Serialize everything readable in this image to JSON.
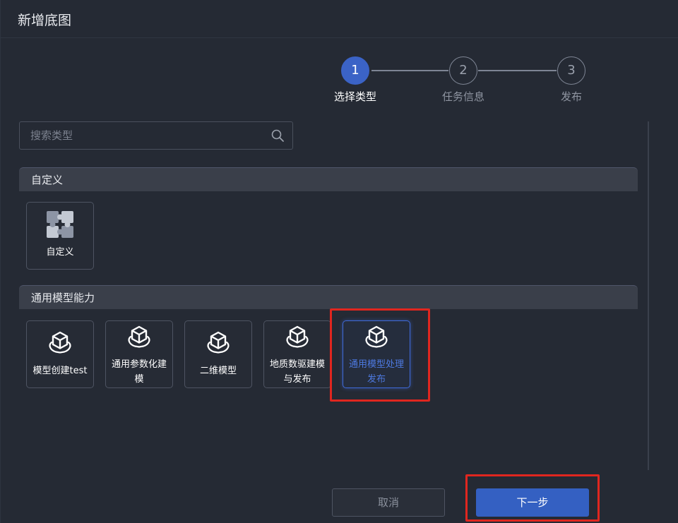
{
  "dialog": {
    "title": "新增底图"
  },
  "steps": [
    {
      "number": "1",
      "label": "选择类型",
      "active": true
    },
    {
      "number": "2",
      "label": "任务信息",
      "active": false
    },
    {
      "number": "3",
      "label": "发布",
      "active": false
    }
  ],
  "search": {
    "placeholder": "搜索类型",
    "value": ""
  },
  "sections": [
    {
      "title": "自定义",
      "items": [
        {
          "label": "自定义",
          "icon": "puzzle-icon"
        }
      ]
    },
    {
      "title": "通用模型能力",
      "items": [
        {
          "label": "模型创建test",
          "icon": "cube-icon"
        },
        {
          "label": "通用参数化建模",
          "icon": "cube-icon"
        },
        {
          "label": "二维模型",
          "icon": "cube-icon"
        },
        {
          "label": "地质数驱建模与发布",
          "icon": "cube-icon"
        },
        {
          "label": "通用模型处理发布",
          "icon": "cube-icon",
          "selected": true
        }
      ]
    }
  ],
  "footer": {
    "cancel_label": "取消",
    "next_label": "下一步"
  },
  "colors": {
    "accent": "#3b63c6",
    "highlight": "#e0261f",
    "background": "#252a34"
  }
}
